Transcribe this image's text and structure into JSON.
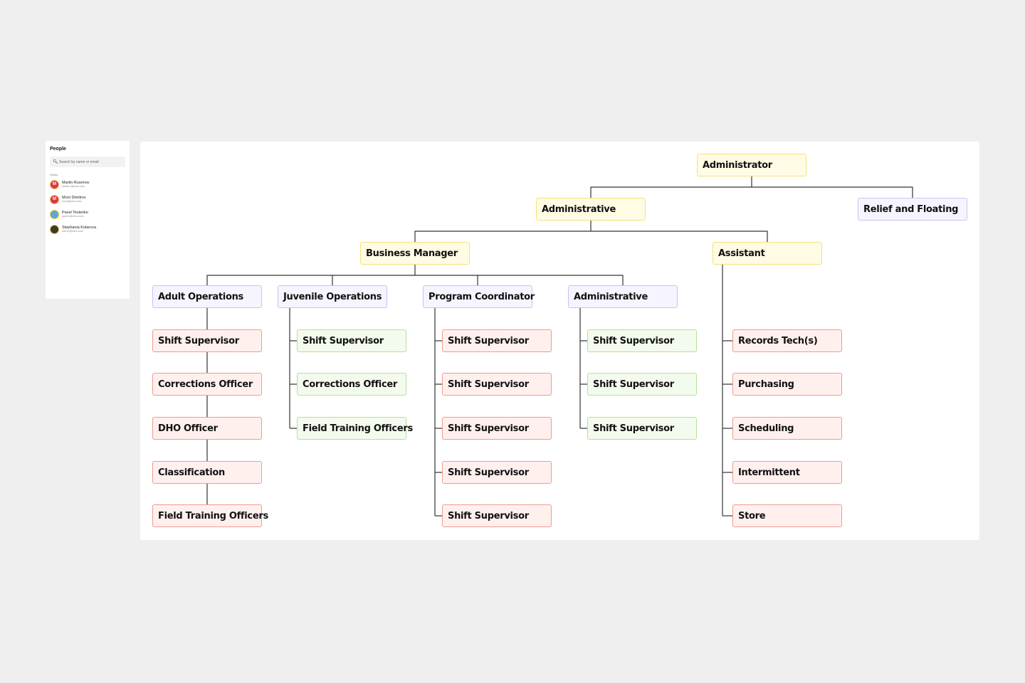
{
  "people_panel": {
    "title": "People",
    "search_placeholder": "Search by name or email",
    "section_label": "Online",
    "people": [
      {
        "name": "Martin Rusenov",
        "email": "martin.r@miro.com",
        "initial": "M",
        "color": "#e0344a"
      },
      {
        "name": "Moni Dimitrov",
        "email": "moni@miro.com",
        "initial": "M",
        "color": "#e0344a"
      },
      {
        "name": "Pavel Teslenko",
        "email": "pavel.t@miro.com",
        "initial": "",
        "color": "#5aa7d8"
      },
      {
        "name": "Stephania Kolarova",
        "email": "s5212@miro.com",
        "initial": "",
        "color": "#3a3a2a"
      }
    ]
  },
  "org_chart": {
    "root": "Administrator",
    "level1": {
      "left": "Administrative",
      "right": "Relief and Floating"
    },
    "level2": {
      "left": "Business Manager",
      "right": "Assistant"
    },
    "departments": [
      {
        "title": "Adult Operations",
        "children": [
          "Shift Supervisor",
          "Corrections Officer",
          "DHO Officer",
          "Classification",
          "Field Training Officers"
        ]
      },
      {
        "title": "Juvenile Operations",
        "children": [
          "Shift Supervisor",
          "Corrections Officer",
          "Field Training Officers"
        ]
      },
      {
        "title": "Program Coordinator",
        "children": [
          "Shift Supervisor",
          "Shift Supervisor",
          "Shift Supervisor",
          "Shift Supervisor",
          "Shift Supervisor"
        ]
      },
      {
        "title": "Administrative",
        "children": [
          "Shift Supervisor",
          "Shift Supervisor",
          "Shift Supervisor"
        ]
      }
    ],
    "assistant_children": [
      "Records Tech(s)",
      "Purchasing",
      "Scheduling",
      "Intermittent",
      "Store"
    ],
    "colors": {
      "yellow": "#fffbe5",
      "purple": "#f6f4ff",
      "red": "#fff0ee",
      "green": "#f3fbee",
      "connector": "#333333"
    }
  }
}
